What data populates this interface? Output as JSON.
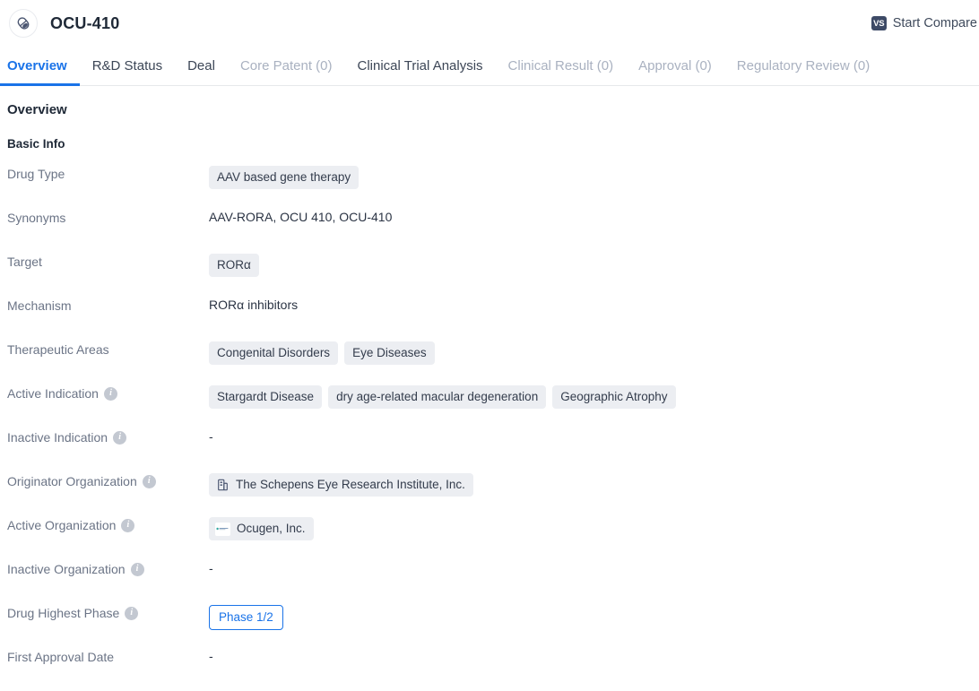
{
  "header": {
    "drug_icon": "pill-capsule-icon",
    "title": "OCU-410",
    "compare": {
      "badge": "VS",
      "label": "Start Compare"
    }
  },
  "tabs": [
    {
      "label": "Overview",
      "state": "active"
    },
    {
      "label": "R&D Status",
      "state": "enabled"
    },
    {
      "label": "Deal",
      "state": "enabled"
    },
    {
      "label": "Core Patent (0)",
      "state": "disabled"
    },
    {
      "label": "Clinical Trial Analysis",
      "state": "enabled"
    },
    {
      "label": "Clinical Result (0)",
      "state": "disabled"
    },
    {
      "label": "Approval (0)",
      "state": "disabled"
    },
    {
      "label": "Regulatory Review (0)",
      "state": "disabled"
    }
  ],
  "main": {
    "section_title": "Overview",
    "subsection_title": "Basic Info",
    "rows": [
      {
        "label": "Drug Type",
        "info": false,
        "type": "tags",
        "values": [
          "AAV based gene therapy"
        ]
      },
      {
        "label": "Synonyms",
        "info": false,
        "type": "text",
        "text": "AAV-RORA,  OCU 410,  OCU-410"
      },
      {
        "label": "Target",
        "info": false,
        "type": "tags",
        "values": [
          "RORα"
        ]
      },
      {
        "label": "Mechanism",
        "info": false,
        "type": "text",
        "text": "RORα inhibitors"
      },
      {
        "label": "Therapeutic Areas",
        "info": false,
        "type": "tags",
        "values": [
          "Congenital Disorders",
          "Eye Diseases"
        ]
      },
      {
        "label": "Active Indication",
        "info": true,
        "type": "tags",
        "values": [
          "Stargardt Disease",
          "dry age-related macular degeneration",
          "Geographic Atrophy"
        ]
      },
      {
        "label": "Inactive Indication",
        "info": true,
        "type": "text",
        "text": "-"
      },
      {
        "label": "Originator Organization",
        "info": true,
        "type": "org",
        "org_icon": "institution-icon",
        "text": "The Schepens Eye Research Institute, Inc."
      },
      {
        "label": "Active Organization",
        "info": true,
        "type": "org-logo",
        "org_icon": "ocugen-logo-icon",
        "text": "Ocugen, Inc."
      },
      {
        "label": "Inactive Organization",
        "info": true,
        "type": "text",
        "text": "-"
      },
      {
        "label": "Drug Highest Phase",
        "info": true,
        "type": "phase",
        "text": "Phase 1/2"
      },
      {
        "label": "First Approval Date",
        "info": false,
        "type": "text",
        "text": "-"
      }
    ]
  },
  "colors": {
    "accent_blue": "#1a73e8",
    "tag_bg": "#eceef2",
    "label_text": "#6b7486",
    "value_text": "#2b3444",
    "disabled_tab": "#a9b1c0",
    "vs_badge_bg": "#3d4a66",
    "ocugen_logo": "#2fa8a0"
  }
}
